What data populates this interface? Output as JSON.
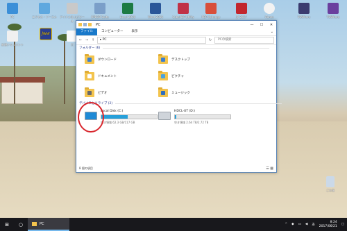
{
  "desktop": {
    "icons": [
      {
        "label": "PC",
        "color": "#3b8fd8"
      },
      {
        "label": "エクセル・ソースル",
        "color": "#5ea8df"
      },
      {
        "label": "アイドル仕上げツール",
        "color": "#c9c9c9"
      },
      {
        "label": "OPEOR Suite",
        "color": "#7b9fc9"
      },
      {
        "label": "Excel 2016",
        "color": "#1d7a43"
      },
      {
        "label": "Word 2016",
        "color": "#2a5699"
      },
      {
        "label": "CubePDF Utility",
        "color": "#c03146"
      },
      {
        "label": "PDF-Xchange",
        "color": "#d84e3a"
      },
      {
        "label": "JP 2017",
        "color": "#c2262d"
      },
      {
        "label": "iTunes",
        "color": "#f2f2f2"
      },
      {
        "label": "VSWhere",
        "color": "#3b3b6f"
      },
      {
        "label": "VSWhere",
        "color": "#6a3f9e"
      }
    ],
    "left_icons": [
      {
        "label": "Jww",
        "color": "#2a3d8f"
      },
      {
        "label": "新規ドキュメント",
        "color": "#f0f0f0"
      },
      {
        "label": "日",
        "color": "#fafafa"
      }
    ],
    "recycle_bin": "ごみ箱"
  },
  "explorer": {
    "title": "PC",
    "ribbon_tabs": [
      "ファイル",
      "コンピューター",
      "表示"
    ],
    "address": "PC",
    "search_placeholder": "PCの検索",
    "folders_header": "フォルダー (6)",
    "folders": [
      {
        "name": "ダウンロード",
        "icon": "download-folder-icon",
        "color": "#3b7fd1"
      },
      {
        "name": "デスクトップ",
        "icon": "desktop-folder-icon",
        "color": "#3b7fd1"
      },
      {
        "name": "ドキュメント",
        "icon": "documents-folder-icon",
        "color": "#ffffff"
      },
      {
        "name": "ピクチャ",
        "icon": "pictures-folder-icon",
        "color": "#4aa3df"
      },
      {
        "name": "ビデオ",
        "icon": "videos-folder-icon",
        "color": "#6a6a6a"
      },
      {
        "name": "ミュージック",
        "icon": "music-folder-icon",
        "color": "#2f6fbf"
      }
    ],
    "devices_header": "デバイスとドライブ (2)",
    "drives": [
      {
        "name": "Local Disk (C:)",
        "free": "空き領域 62.3 GB/117 GB",
        "used_fraction": 0.47
      },
      {
        "name": "HDCL-UT (D:)",
        "free": "空き領域 2.64 TB/2.72 TB",
        "used_fraction": 0.03
      }
    ],
    "status": "8 個の項目"
  },
  "taskbar": {
    "task_label": "PC",
    "time": "8:24",
    "date": "2017/06/21",
    "ime": "あ"
  }
}
